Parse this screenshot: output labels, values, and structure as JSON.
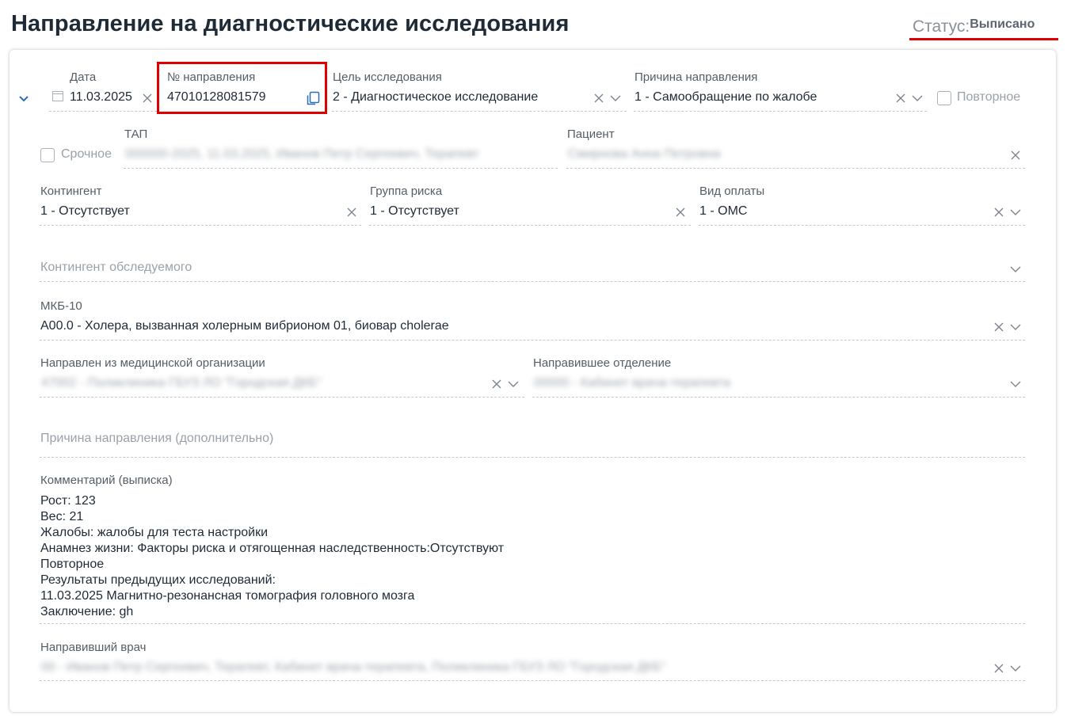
{
  "page": {
    "title": "Направление на диагностические исследования",
    "status_label": "Статус:",
    "status_value": "Выписано"
  },
  "colors": {
    "highlight": "#e00000",
    "text": "#1f2a36",
    "label": "#555d66",
    "muted": "#9aa1a9"
  },
  "form": {
    "date": {
      "label": "Дата",
      "value": "11.03.2025"
    },
    "referral_number": {
      "label": "№ направления",
      "value": "47010128081579"
    },
    "purpose": {
      "label": "Цель исследования",
      "value": "2 - Диагностическое исследование"
    },
    "reason": {
      "label": "Причина направления",
      "value": "1 - Самообращение по жалобе"
    },
    "repeat": {
      "label": "Повторное",
      "checked": false
    },
    "urgent": {
      "label": "Срочное",
      "checked": false
    },
    "tap": {
      "label": "ТАП",
      "value": "000000-2025, 11.03.2025, Иванов Петр Сергеевич, Терапевт"
    },
    "patient": {
      "label": "Пациент",
      "value": "Смирнова Анна Петровна"
    },
    "contingent": {
      "label": "Контингент",
      "value": "1 - Отсутствует"
    },
    "risk_group": {
      "label": "Группа риска",
      "value": "1 - Отсутствует"
    },
    "payment_type": {
      "label": "Вид оплаты",
      "value": "1 - ОМС"
    },
    "examined_contingent": {
      "placeholder": "Контингент обследуемого"
    },
    "mkb10": {
      "label": "МКБ-10",
      "value": "A00.0 - Холера, вызванная холерным вибрионом 01, биовар cholerae"
    },
    "sending_org": {
      "label": "Направлен из медицинской организации",
      "value": "47002 - Поликлиника ГБУЗ ЛО \"Городская ДКБ\""
    },
    "sending_department": {
      "label": "Направившее отделение",
      "value": "00000 - Кабинет врача-терапевта"
    },
    "reason_extra": {
      "placeholder": "Причина направления (дополнительно)"
    },
    "comment": {
      "label": "Комментарий (выписка)",
      "lines": [
        "Рост: 123",
        "Вес: 21",
        "Жалобы: жалобы для теста настройки",
        "Анамнез жизни: Факторы риска и отягощенная наследственность:Отсутствуют",
        "Повторное",
        "Результаты предыдущих исследований:",
        "11.03.2025 Магнитно-резонансная томография головного мозга",
        "Заключение: gh"
      ]
    },
    "doctor": {
      "label": "Направивший врач",
      "value": "00 - Иванов Петр Сергеевич, Терапевт, Кабинет врача-терапевта, Поликлиника ГБУЗ ЛО \"Городская ДКБ\""
    }
  }
}
